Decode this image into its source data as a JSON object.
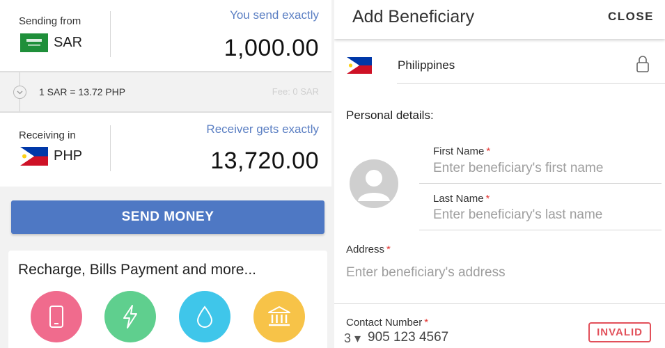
{
  "sender": {
    "label": "Sending from",
    "currency": "SAR",
    "amount_label": "You send exactly",
    "amount": "1,000.00"
  },
  "rate": {
    "text": "1 SAR = 13.72 PHP",
    "fee": "Fee: 0 SAR"
  },
  "receiver": {
    "label": "Receiving in",
    "currency": "PHP",
    "amount_label": "Receiver gets exactly",
    "amount": "13,720.00"
  },
  "send_button": "SEND MONEY",
  "services": {
    "title": "Recharge, Bills Payment and more...",
    "items": [
      {
        "icon": "mobile-phone-icon",
        "color": "#f06b8d"
      },
      {
        "icon": "lightning-bolt-icon",
        "color": "#5fcf8e"
      },
      {
        "icon": "water-drop-icon",
        "color": "#3fc6ea"
      },
      {
        "icon": "bank-icon",
        "color": "#f7c348"
      }
    ]
  },
  "beneficiary": {
    "title": "Add Beneficiary",
    "close": "CLOSE",
    "country": "Philippines",
    "personal_label": "Personal details:",
    "first_name": {
      "label": "First Name",
      "required": "*",
      "placeholder": "Enter beneficiary's first name"
    },
    "last_name": {
      "label": "Last Name",
      "required": "*",
      "placeholder": "Enter beneficiary's last name"
    },
    "address": {
      "label": "Address",
      "required": "*",
      "placeholder": "Enter beneficiary's address"
    },
    "contact": {
      "label": "Contact Number",
      "required": "*",
      "prefix": "3 ▾",
      "value": "905 123 4567",
      "status": "INVALID"
    }
  },
  "colors": {
    "accent_blue": "#4e78c4",
    "amount_label_blue": "#5b7fc3",
    "error_red": "#e2505a",
    "saudi_green": "#1f8f3a",
    "ph_blue": "#0038a8",
    "ph_red": "#ce1126",
    "ph_yellow": "#fcd116"
  }
}
